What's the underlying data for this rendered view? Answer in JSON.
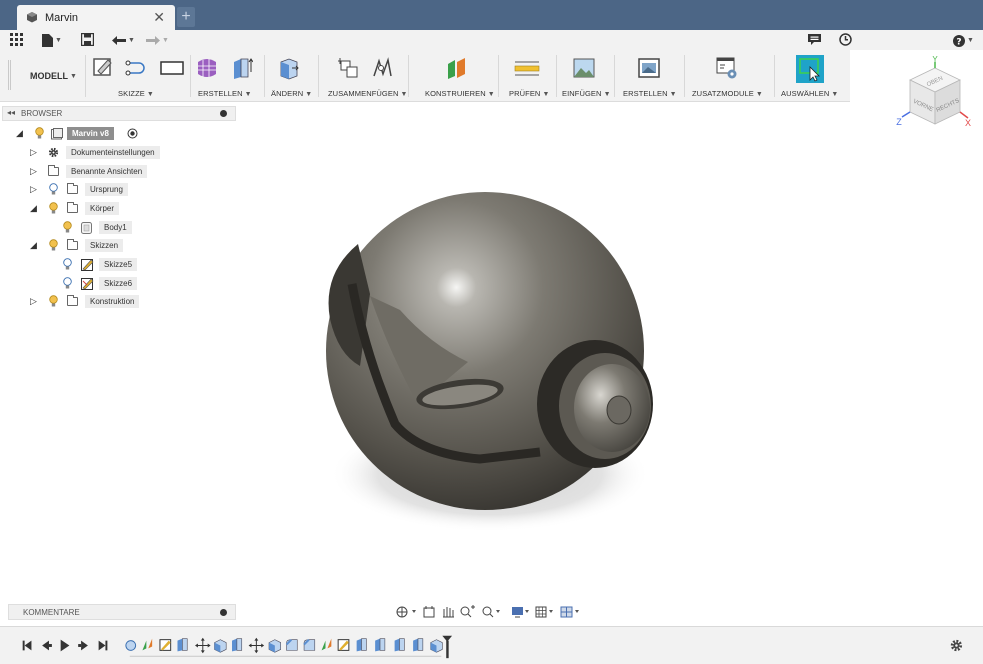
{
  "document": {
    "tab_title": "Marvin",
    "close_glyph": "✕",
    "new_tab_glyph": "+"
  },
  "quick_access": {
    "items": [
      "apps-grid-icon",
      "file-menu-icon",
      "save-icon",
      "undo-icon",
      "redo-icon"
    ],
    "right_items": [
      "notifications-icon",
      "job-status-icon",
      "help-icon"
    ]
  },
  "ribbon": {
    "workspace": "MODELL",
    "groups": [
      {
        "name": "SKIZZE"
      },
      {
        "name": "ERSTELLEN"
      },
      {
        "name": "ÄNDERN"
      },
      {
        "name": "ZUSAMMENFÜGEN"
      },
      {
        "name": "KONSTRUIEREN"
      },
      {
        "name": "PRÜFEN"
      },
      {
        "name": "EINFÜGEN"
      },
      {
        "name": "ERSTELLEN"
      },
      {
        "name": "ZUSATZMODULE"
      },
      {
        "name": "AUSWÄHLEN"
      }
    ],
    "accent": "#1fa3c8"
  },
  "viewcube": {
    "top": "OBEN",
    "front": "VORNE",
    "right": "RECHTS",
    "axis_x": "X",
    "axis_y": "Y",
    "axis_z": "Z"
  },
  "browser": {
    "title": "BROWSER",
    "collapse_glyph": "◂◂",
    "tree": [
      {
        "label": "Marvin v8"
      },
      {
        "label": "Dokumenteinstellungen"
      },
      {
        "label": "Benannte Ansichten"
      },
      {
        "label": "Ursprung"
      },
      {
        "label": "Körper"
      },
      {
        "label": "Body1"
      },
      {
        "label": "Skizzen"
      },
      {
        "label": "Skizze5"
      },
      {
        "label": "Skizze6"
      },
      {
        "label": "Konstruktion"
      }
    ]
  },
  "comments": {
    "title": "KOMMENTARE"
  },
  "navigation": {
    "items": [
      "orbit-icon",
      "look-at-icon",
      "pan-icon",
      "zoom-icon",
      "fit-icon",
      "display-settings-icon",
      "grid-settings-icon",
      "viewports-icon"
    ]
  },
  "timeline": {
    "controls": [
      "go-to-start",
      "step-back",
      "play",
      "step-forward",
      "go-to-end"
    ],
    "settings_icon": "gear-icon"
  },
  "colors": {
    "tabbar": "#4c6686",
    "bulb": "#f2c14e",
    "selected_node": "#8e8e8e"
  }
}
